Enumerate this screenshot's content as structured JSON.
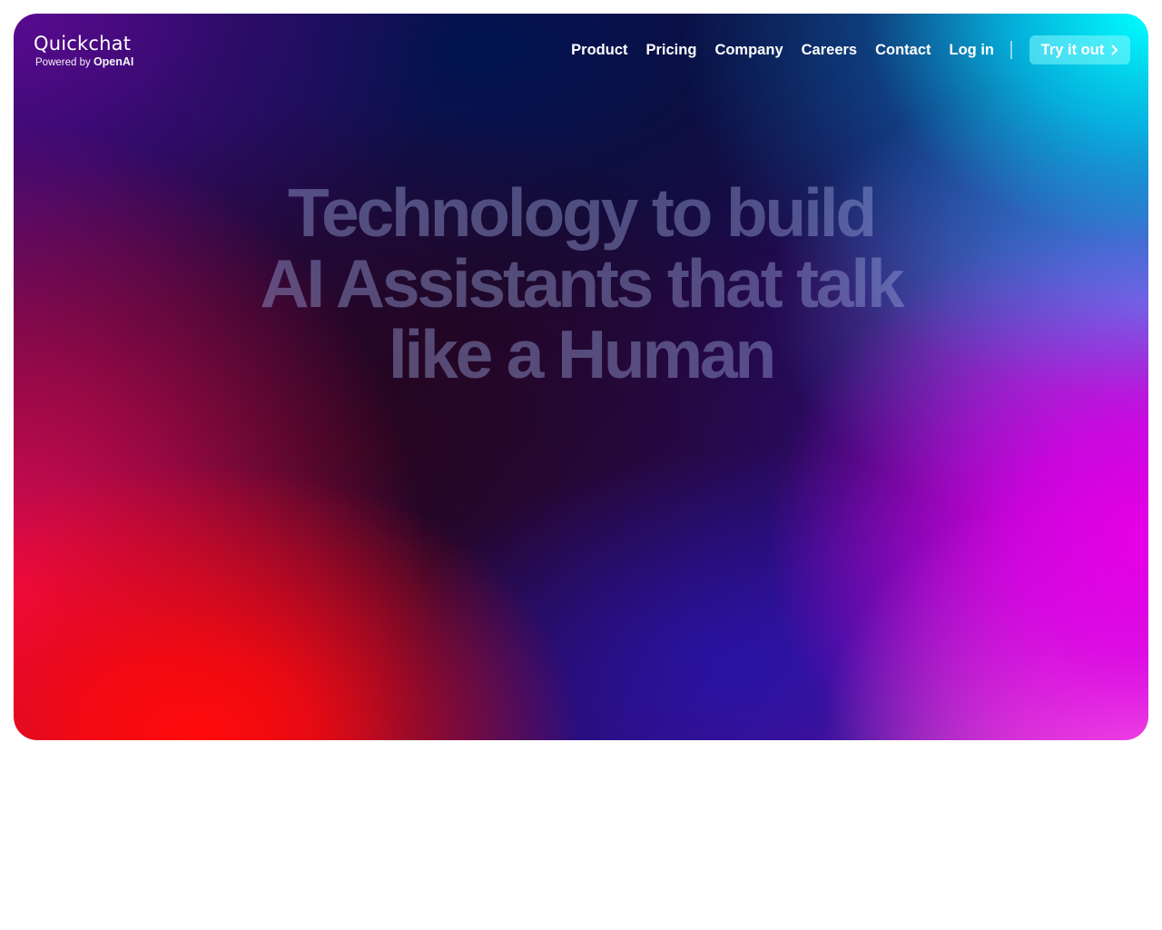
{
  "logo": {
    "name": "Quickchat",
    "powered_by": "Powered by",
    "partner": "OpenAI"
  },
  "nav": {
    "items": [
      {
        "label": "Product"
      },
      {
        "label": "Pricing"
      },
      {
        "label": "Company"
      },
      {
        "label": "Careers"
      },
      {
        "label": "Contact"
      },
      {
        "label": "Log in"
      }
    ],
    "cta_label": "Try it out",
    "cta_icon": "chevron-right-icon"
  },
  "hero": {
    "headline_lines": [
      "Technology to build",
      "AI Assistants that talk",
      "like a Human"
    ]
  },
  "colors": {
    "hero_red": "#ff0a0a",
    "hero_cyan": "#00ffff",
    "hero_magenta": "#e600e6",
    "hero_pink": "#ff80e0",
    "hero_navy": "#001450",
    "cta_background": "#82faff",
    "page_background": "#ffffff"
  }
}
